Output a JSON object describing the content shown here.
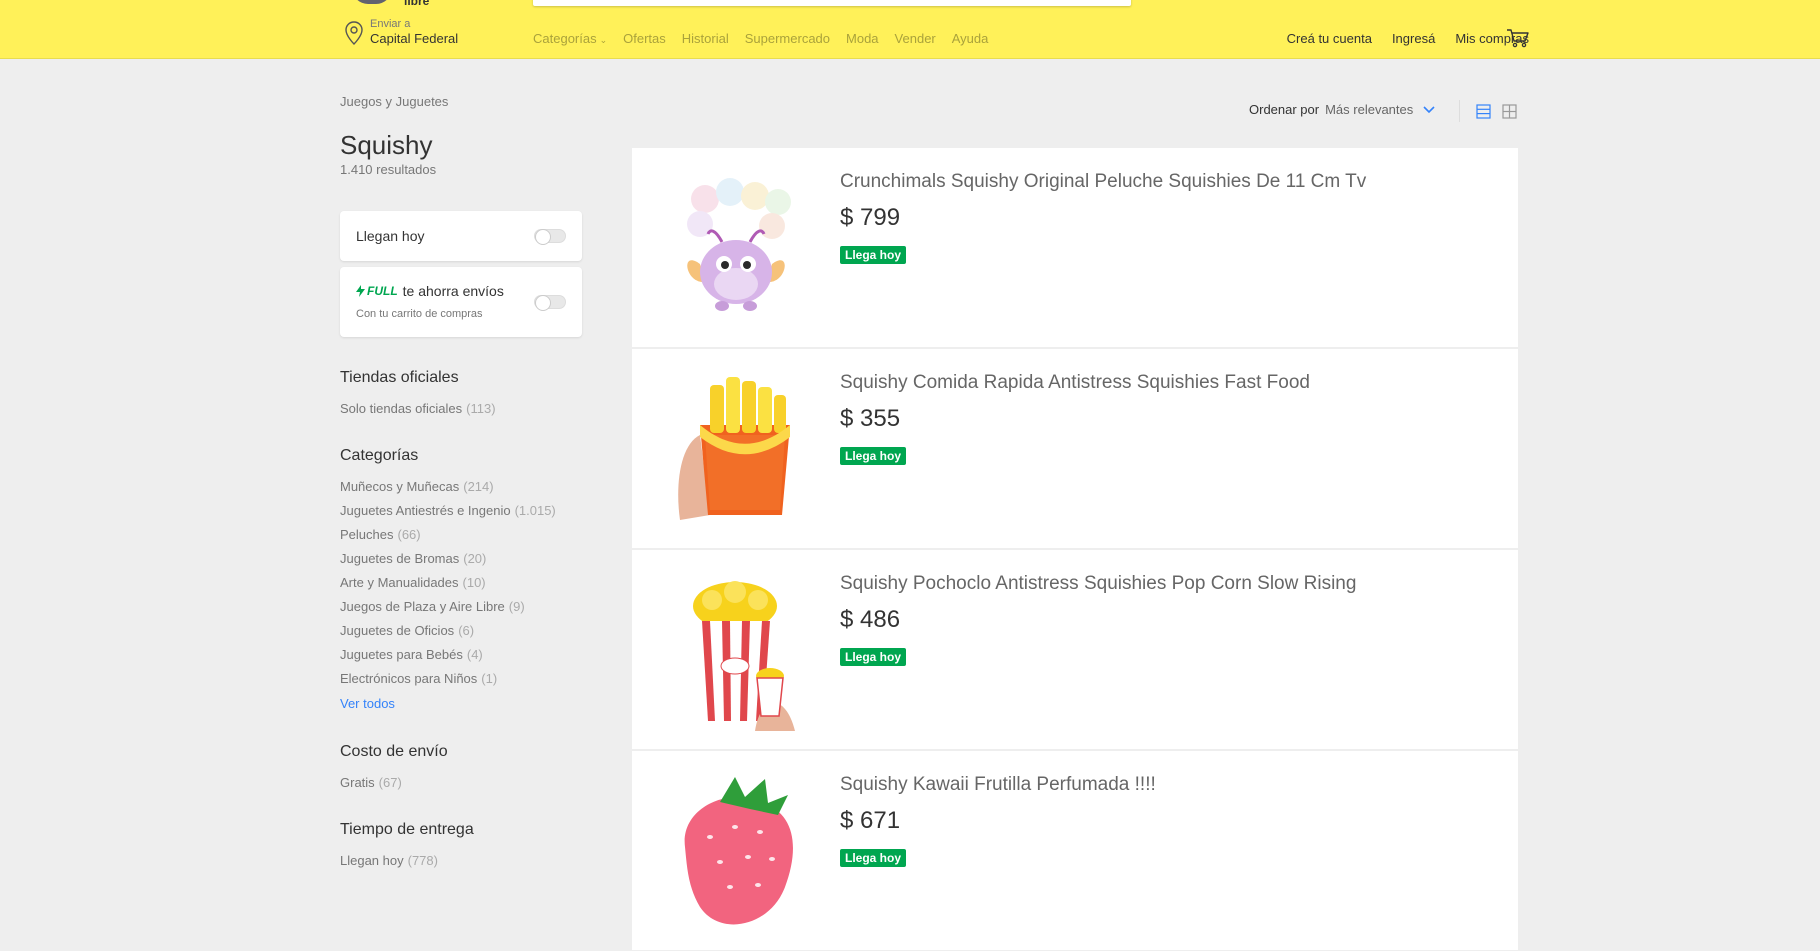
{
  "header": {
    "logo_partial_text": "libre",
    "location": {
      "small": "Enviar a",
      "big": "Capital Federal"
    },
    "nav": [
      {
        "label": "Categorías"
      },
      {
        "label": "Ofertas"
      },
      {
        "label": "Historial"
      },
      {
        "label": "Supermercado"
      },
      {
        "label": "Moda"
      },
      {
        "label": "Vender"
      },
      {
        "label": "Ayuda"
      }
    ],
    "user_links": {
      "create": "Creá tu cuenta",
      "login": "Ingresá",
      "purchases": "Mis compras"
    }
  },
  "sidebar": {
    "breadcrumb": "Juegos y Juguetes",
    "title": "Squishy",
    "results_count": "1.410 resultados",
    "filter_today": "Llegan hoy",
    "filter_full": {
      "badge": "FULL",
      "label": "te ahorra envíos",
      "sub": "Con tu carrito de compras"
    },
    "official_stores": {
      "title": "Tiendas oficiales",
      "link": "Solo tiendas oficiales",
      "qty": "(113)"
    },
    "categories": {
      "title": "Categorías",
      "items": [
        {
          "label": "Muñecos y Muñecas",
          "qty": "(214)"
        },
        {
          "label": "Juguetes Antiestrés e Ingenio",
          "qty": "(1.015)"
        },
        {
          "label": "Peluches",
          "qty": "(66)"
        },
        {
          "label": "Juguetes de Bromas",
          "qty": "(20)"
        },
        {
          "label": "Arte y Manualidades",
          "qty": "(10)"
        },
        {
          "label": "Juegos de Plaza y Aire Libre",
          "qty": "(9)"
        },
        {
          "label": "Juguetes de Oficios",
          "qty": "(6)"
        },
        {
          "label": "Juguetes para Bebés",
          "qty": "(4)"
        },
        {
          "label": "Electrónicos para Niños",
          "qty": "(1)"
        }
      ],
      "view_all": "Ver todos"
    },
    "shipping_cost": {
      "title": "Costo de envío",
      "link": "Gratis",
      "qty": "(67)"
    },
    "delivery_time": {
      "title": "Tiempo de entrega",
      "link": "Llegan hoy",
      "qty": "(778)"
    }
  },
  "sort": {
    "label": "Ordenar por",
    "value": "Más relevantes"
  },
  "results": [
    {
      "title": "Crunchimals Squishy Original Peluche Squishies De 11 Cm Tv",
      "price": "$ 799",
      "badge": "Llega hoy",
      "image": "plush-butterfly"
    },
    {
      "title": "Squishy Comida Rapida Antistress Squishies Fast Food",
      "price": "$ 355",
      "badge": "Llega hoy",
      "image": "french-fries"
    },
    {
      "title": "Squishy Pochoclo Antistress Squishies Pop Corn Slow Rising",
      "price": "$ 486",
      "badge": "Llega hoy",
      "image": "popcorn"
    },
    {
      "title": "Squishy Kawaii Frutilla Perfumada !!!!",
      "price": "$ 671",
      "badge": "Llega hoy",
      "image": "strawberry"
    }
  ],
  "colors": {
    "header_bg": "#fff159",
    "badge_green": "#00a650",
    "link_blue": "#3483fa"
  }
}
